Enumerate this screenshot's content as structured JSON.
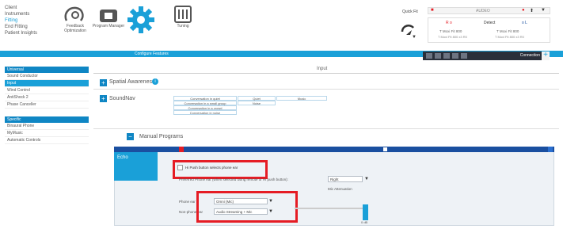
{
  "left_nav": [
    "Client",
    "Instruments",
    "Fitting",
    "End Fitting",
    "Patient Insights"
  ],
  "toolbar": {
    "feedback_label": "Feedback Optimization",
    "program_label": "Program Manager",
    "tuning_label": "Tuning",
    "configure_label": "Configure Features"
  },
  "quickfit": {
    "label": "Quick Fit",
    "device_name": "AUDEO",
    "left_ear": "R o",
    "status": "Detect",
    "right_ear": "o L",
    "left_line1": "T Moxi Fit 800",
    "left_line2": "T Moxi Fit 800 x3 R0",
    "right_line1": "T Moxi Fit 800",
    "right_line2": "T Moxi Fit 800 x3 R0"
  },
  "connection_label": "Connection",
  "sidebar": {
    "universal_head": "Universal",
    "universal_items": [
      "Sound Conductor",
      "Input",
      "Wind Control",
      "AntiShock 2",
      "Phase Canceller"
    ],
    "specific_head": "Specific",
    "specific_items": [
      "Binaural Phone",
      "MyMusic",
      "Automatic Controls"
    ]
  },
  "main": {
    "input_header": "Input",
    "spatial_label": "Spatial Awareness",
    "soundnav_label": "SoundNav",
    "soundnav_col1": [
      "Conversation in quiet",
      "Conversation in a small group",
      "Conversation in a crowd",
      "Conversation in noise"
    ],
    "soundnav_col2": [
      "Quiet",
      "Noise"
    ],
    "soundnav_col3": [
      "Music"
    ],
    "manual_label": "Manual Programs"
  },
  "program_panel": {
    "tab_label": "Echo",
    "checkbox_label": "Hi Push button selects phone ear",
    "preferred_label": "Preferred Phone ear (when selected using remote or Hi push button):",
    "preferred_value": "Right",
    "attenuation_label": "Mic Attenuation",
    "phone_ear_label": "Phone ear",
    "phone_ear_value": "Omni (Mic)",
    "nonphone_label": "Non-phone ear",
    "nonphone_value": "Audio Streaming + Mic",
    "slider_value": "0 dB"
  }
}
